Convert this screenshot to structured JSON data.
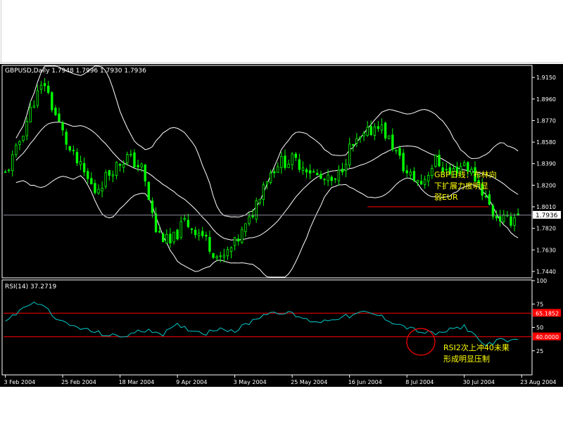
{
  "chart_data": [
    {
      "type": "line",
      "subtype": "candlestick-with-bollinger-bands",
      "header": "GBPUSD,Daily  1.7948 1.7996 1.7930 1.7936",
      "symbol": "GBPUSD",
      "timeframe": "Daily",
      "last_ohlc": {
        "open": 1.7948,
        "high": 1.7996,
        "low": 1.793,
        "close": 1.7936
      },
      "last_price_label": "1.7936",
      "ylim": [
        1.739,
        1.925
      ],
      "y_ticks": [
        "1.9150",
        "1.8960",
        "1.8770",
        "1.8580",
        "1.8390",
        "1.8200",
        "1.8010",
        "1.7820",
        "1.7630",
        "1.7440"
      ],
      "horizontal_line": {
        "value": 1.801,
        "color": "#ff0000"
      },
      "price_path_x": [
        0,
        3,
        8,
        11,
        13,
        18,
        22,
        25,
        30,
        34,
        38,
        42,
        46,
        50,
        55,
        60,
        64,
        68,
        72,
        76,
        80,
        84,
        88,
        92,
        96,
        100,
        104,
        108,
        112,
        116,
        120,
        124,
        128,
        132,
        136,
        140,
        143
      ],
      "price_path_y": [
        1.83,
        1.85,
        1.895,
        1.91,
        1.89,
        1.85,
        1.83,
        1.815,
        1.835,
        1.845,
        1.835,
        1.78,
        1.768,
        1.788,
        1.776,
        1.753,
        1.768,
        1.788,
        1.822,
        1.84,
        1.842,
        1.836,
        1.825,
        1.822,
        1.852,
        1.862,
        1.875,
        1.855,
        1.83,
        1.822,
        1.842,
        1.83,
        1.84,
        1.822,
        1.795,
        1.788,
        1.7936
      ],
      "annotation": [
        "GBP日线：布林向",
        "下扩展力度明显",
        "弱EUR"
      ]
    },
    {
      "type": "line",
      "title": "RSI(14)  37.2719",
      "ylim": [
        0,
        100
      ],
      "y_ticks": [
        "100",
        "75",
        "50",
        "25"
      ],
      "levels": [
        {
          "value": 65.1852,
          "label": "65.1852",
          "color": "#ff0000"
        },
        {
          "value": 40.0,
          "label": "40.0000",
          "color": "#ff0000"
        }
      ],
      "series": [
        {
          "color": "#00c8c8",
          "x": [
            0,
            3,
            6,
            9,
            12,
            16,
            20,
            24,
            28,
            32,
            36,
            40,
            44,
            48,
            52,
            56,
            60,
            64,
            68,
            72,
            76,
            80,
            84,
            88,
            92,
            96,
            100,
            104,
            108,
            112,
            116,
            120,
            124,
            128,
            131,
            133,
            135,
            138,
            140,
            143
          ],
          "values": [
            58,
            64,
            74,
            76,
            68,
            55,
            50,
            46,
            42,
            40,
            44,
            48,
            43,
            52,
            47,
            44,
            50,
            46,
            55,
            64,
            67,
            64,
            58,
            56,
            60,
            62,
            66,
            63,
            56,
            50,
            45,
            43,
            47,
            51,
            42,
            32,
            33,
            36,
            35,
            37
          ]
        }
      ],
      "annotation": [
        "RSI2次上冲40未果",
        "形成明显压制"
      ]
    }
  ],
  "x_axis": {
    "tick_labels": [
      "3 Feb 2004",
      "25 Feb 2004",
      "18 Mar 2004",
      "9 Apr 2004",
      "3 May 2004",
      "25 May 2004",
      "16 Jun 2004",
      "8 Jul 2004",
      "30 Jul 2004",
      "23 Aug 2004"
    ],
    "tick_bar_index": [
      0,
      16,
      32,
      48,
      64,
      80,
      96,
      112,
      128,
      144
    ]
  },
  "colors": {
    "background": "#000000",
    "candle": "#00ff00",
    "band": "#ffffff",
    "annotation": "#ffff00",
    "rsi": "#00c8c8",
    "level": "#ff0000"
  }
}
